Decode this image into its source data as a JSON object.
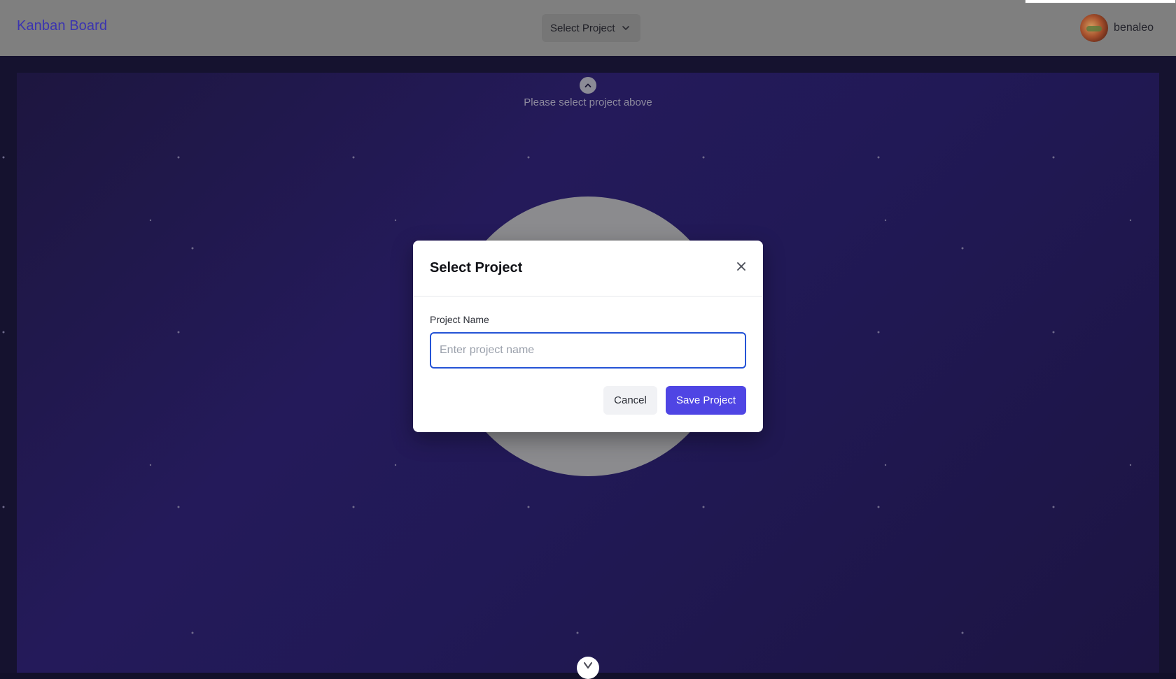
{
  "header": {
    "brand": "Kanban Board",
    "project_select_label": "Select Project",
    "username": "benaleo"
  },
  "board": {
    "hint_text": "Please select project above"
  },
  "modal": {
    "title": "Select Project",
    "field_label": "Project Name",
    "input_value": "",
    "input_placeholder": "Enter project name",
    "cancel_label": "Cancel",
    "save_label": "Save Project"
  },
  "colors": {
    "brand": "#3b34b0",
    "primary_button": "#4f45e4",
    "input_focus_border": "#2453d6",
    "board_background": "#221957"
  },
  "icons": {
    "project_select": "chevron-down-icon",
    "hint": "chevron-up-icon",
    "close": "close-icon",
    "bottom": "chevron-down-icon"
  }
}
